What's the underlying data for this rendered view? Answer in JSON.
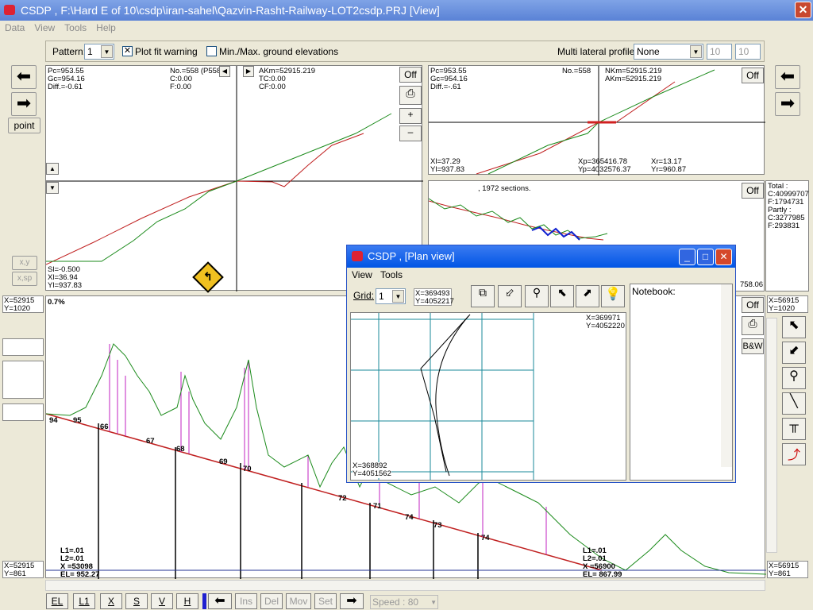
{
  "window": {
    "title": "CSDP , F:\\Hard E of 10\\csdp\\iran-sahel\\Qazvin-Rasht-Railway-LOT2csdp.PRJ [View]",
    "close": "✕"
  },
  "menu": [
    "Data",
    "View",
    "Tools",
    "Help"
  ],
  "toolbar": {
    "pattern_label": "Pattern:",
    "pattern_value": "1",
    "plot_fit_label": "Plot fit warning",
    "plot_fit_check": "✕",
    "minmax_label": "Min./Max. ground elevations",
    "multi_label": "Multi lateral profiles:",
    "multi_value": "None",
    "field1": "10",
    "field2": "10"
  },
  "left_nav": {
    "point_label": "point",
    "xy_label": "x,y",
    "xsp_label": "x,sp"
  },
  "profile_top": {
    "pc": "Pc=953.55",
    "gc": "Gc=954.16",
    "diff": "Diff.=-0.61",
    "no": "No.=558 (P558",
    "c": "C:0.00",
    "f": "F:0.00",
    "akm": "AKm=52915.219",
    "tc": "TC:0.00",
    "cf": "CF:0.00",
    "sl": "Sl=-0.500",
    "xl": "Xl=36.94",
    "yl": "Yl=937.83",
    "off": "Off",
    "plus": "+",
    "minus": "–"
  },
  "right_top": {
    "pc": "Pc=953.55",
    "gc": "Gc=954.16",
    "diff": "Diff.=-.61",
    "no": "No.=558",
    "nkm": "NKm=52915.219",
    "akm": "AKm=52915.219",
    "xl": "Xl=37.29",
    "yl": "Yl=937.83",
    "xp": "Xp=365416.78",
    "yp": "Yp=4032576.37",
    "xr": "Xr=13.17",
    "yr": "Yr=960.87",
    "off": "Off"
  },
  "right_mid": {
    "sections": ", 1972 sections.",
    "off": "Off",
    "val": "758.06"
  },
  "totals": {
    "total": "Total :",
    "c1": "C:40999707",
    "f1": "F:1794731",
    "partly": "Partly :",
    "c2": "C:3277985",
    "f2": "F:293831"
  },
  "coords": {
    "tl": [
      "X=52915",
      "Y=1020"
    ],
    "bl": [
      "X=52915",
      "Y=861"
    ],
    "tr": [
      "X=56915",
      "Y=1020"
    ],
    "br": [
      "X=56915",
      "Y=861"
    ]
  },
  "lower": {
    "grade": "0.7%",
    "labels": [
      "94",
      "95",
      "66",
      "67",
      "68",
      "69",
      "70",
      "71",
      "72",
      "73",
      "74",
      "74"
    ],
    "left_info": [
      "L1=.01",
      "L2=.01",
      "X =53098",
      "EL= 952.27"
    ],
    "right_info": [
      "L1=.01",
      "L2=.01",
      "X =56900",
      "EL= 867.99"
    ],
    "off": "Off",
    "bw": "B&W"
  },
  "bottom_bar": {
    "el": "EL",
    "l1": "L1",
    "x": "X",
    "s": "S",
    "v": "V",
    "h": "H",
    "ins": "Ins",
    "del": "Del",
    "mov": "Mov",
    "set": "Set",
    "speed_label": "Speed :",
    "speed_value": "80"
  },
  "plan": {
    "title": "CSDP , [Plan view]",
    "menu": [
      "View",
      "Tools"
    ],
    "grid_label": "Grid:",
    "grid_value": "1",
    "xy_top": [
      "X=369493",
      "Y=4052217"
    ],
    "xy_canvas_tr": [
      "X=369971",
      "Y=4052220"
    ],
    "xy_canvas_bl": [
      "X=368892",
      "Y=4051562"
    ],
    "notebook": "Notebook:",
    "min": "_",
    "max": "□",
    "close": "✕"
  }
}
